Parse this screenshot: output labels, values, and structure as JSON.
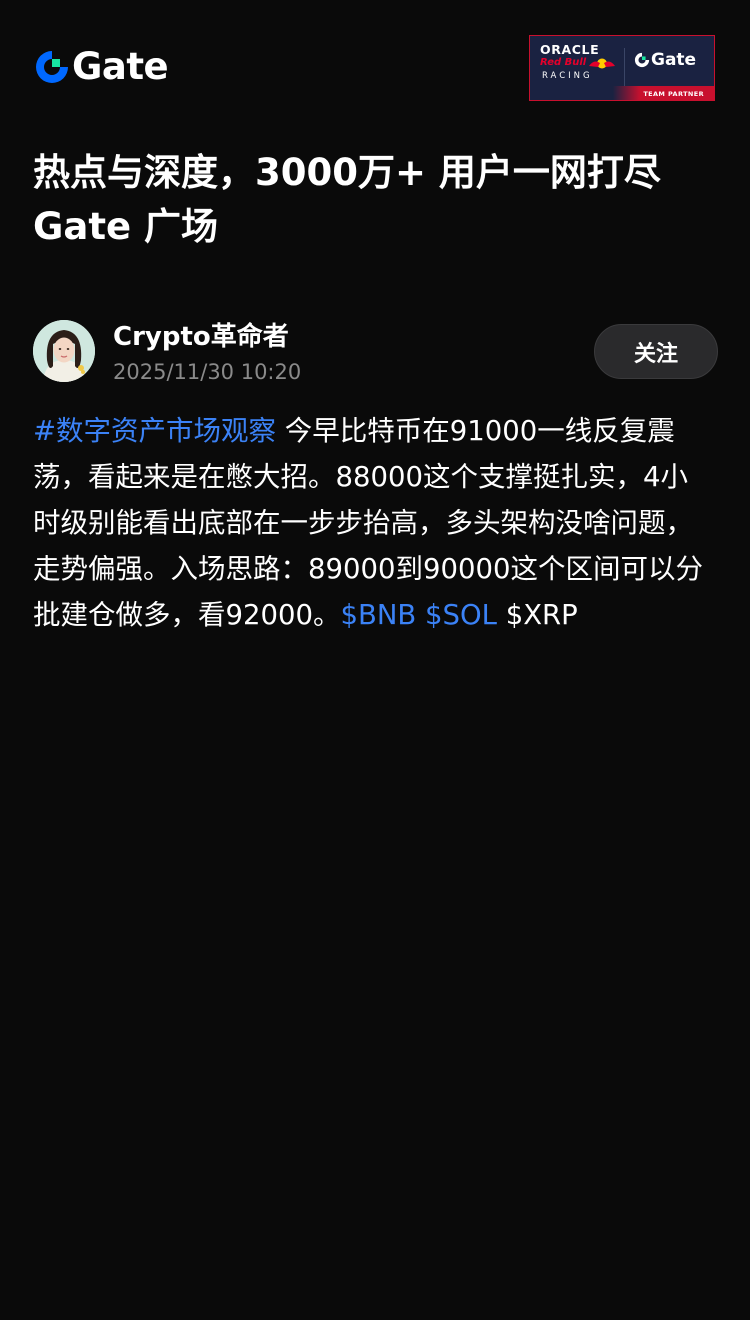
{
  "header": {
    "logo_text": "Gate",
    "partner": {
      "oracle": "ORACLE",
      "redbull": "Red Bull",
      "racing": "RACING",
      "gate": "Gate",
      "team_partner": "TEAM PARTNER"
    }
  },
  "headline": {
    "line1": "热点与深度，3000万+ 用户一网打尽",
    "line2": "Gate 广场"
  },
  "post": {
    "author": "Crypto革命者",
    "time": "2025/11/30 10:20",
    "follow_label": "关注",
    "hashtag": "#数字资产市场观察",
    "body_text": " 今早比特币在91000一线反复震荡，看起来是在憋大招。88000这个支撑挺扎实，4小时级别能看出底部在一步步抬高，多头架构没啥问题，走势偏强。入场思路：89000到90000这个区间可以分批建仓做多，看92000。",
    "ticker_bnb": "$BNB",
    "ticker_sol": "$SOL",
    "ticker_xrp": "$XRP"
  },
  "colors": {
    "background": "#0a0a0a",
    "link": "#3b82f6",
    "brand_blue": "#0068ff",
    "brand_green": "#17e6a1",
    "muted_text": "#8a8a8a",
    "button_bg": "#2a2a2c"
  },
  "icons": {
    "logo": "gate-logo-icon",
    "avatar": "user-avatar"
  }
}
